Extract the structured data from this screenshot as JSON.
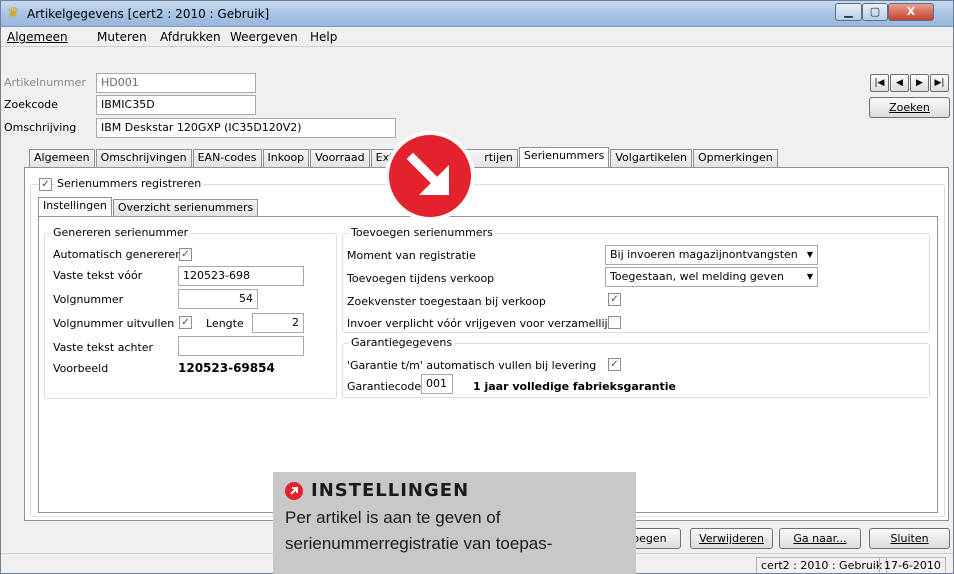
{
  "window": {
    "title": "Artikelgegevens  [cert2 : 2010 : Gebruik]",
    "min_symbol": "▁",
    "max_symbol": "▢",
    "close_symbol": "X"
  },
  "menu": [
    "Algemeen",
    "Muteren",
    "Afdrukken",
    "Weergeven",
    "Help"
  ],
  "header": {
    "artikelnummer_label": "Artikelnummer",
    "artikelnummer_value": "HD001",
    "zoekcode_label": "Zoekcode",
    "zoekcode_value": "IBMIC35D",
    "omschrijving_label": "Omschrijving",
    "omschrijving_value": "IBM Deskstar 120GXP (IC35D120V2)",
    "nav": [
      "|◀",
      "◀",
      "▶",
      "▶|"
    ],
    "zoeken_button": "Zoeken"
  },
  "tabs": [
    "Algemeen",
    "Omschrijvingen",
    "EAN-codes",
    "Inkoop",
    "Voorraad",
    "Extra",
    "A",
    "rtijen",
    "Serienummers",
    "Volgartikelen",
    "Opmerkingen"
  ],
  "active_tab": "Serienummers",
  "register": {
    "label": "Serienummers registreren",
    "checked": "✓"
  },
  "subtabs": [
    "Instellingen",
    "Overzicht serienummers"
  ],
  "generate": {
    "title": "Genereren serienummer",
    "auto_label": "Automatisch genereren",
    "auto_checked": "✓",
    "vaste_voor_label": "Vaste tekst vóór",
    "vaste_voor_value": "120523-698",
    "volgnummer_label": "Volgnummer",
    "volgnummer_value": "54",
    "uitvullen_label": "Volgnummer uitvullen",
    "uitvullen_checked": "✓",
    "lengte_label": "Lengte",
    "lengte_value": "2",
    "vaste_achter_label": "Vaste tekst achter",
    "vaste_achter_value": "",
    "voorbeeld_label": "Voorbeeld",
    "voorbeeld_value": "120523-69854"
  },
  "toevoegen": {
    "title": "Toevoegen serienummers",
    "moment_label": "Moment van registratie",
    "moment_value": "Bij invoeren magazijnontvangsten",
    "verkoop_label": "Toevoegen tijdens verkoop",
    "verkoop_value": "Toegestaan, wel melding geven",
    "zoekvenster_label": "Zoekvenster toegestaan bij verkoop",
    "zoekvenster_checked": "✓",
    "invoer_label": "Invoer verplicht vóór vrijgeven voor verzamellijst",
    "invoer_checked": ""
  },
  "garantie": {
    "title": "Garantiegegevens",
    "auto_label": "'Garantie t/m' automatisch vullen bij levering",
    "auto_checked": "✓",
    "code_label": "Garantiecode",
    "code_value": "001",
    "code_desc": "1 jaar volledige fabrieksgarantie"
  },
  "buttons": {
    "toevoegen": "oegen",
    "verwijderen": "Verwijderen",
    "ganaar": "Ga naar...",
    "sluiten": "Sluiten"
  },
  "status": {
    "context": "cert2 : 2010 : Gebruik",
    "date": "17-6-2010"
  },
  "callout": {
    "heading": "INSTELLINGEN",
    "text": "Per artikel is aan te geven of serienummerregistratie van toepas-"
  },
  "colors": {
    "accent_red": "#e3222b",
    "titlebar": "#a6c3e3"
  }
}
